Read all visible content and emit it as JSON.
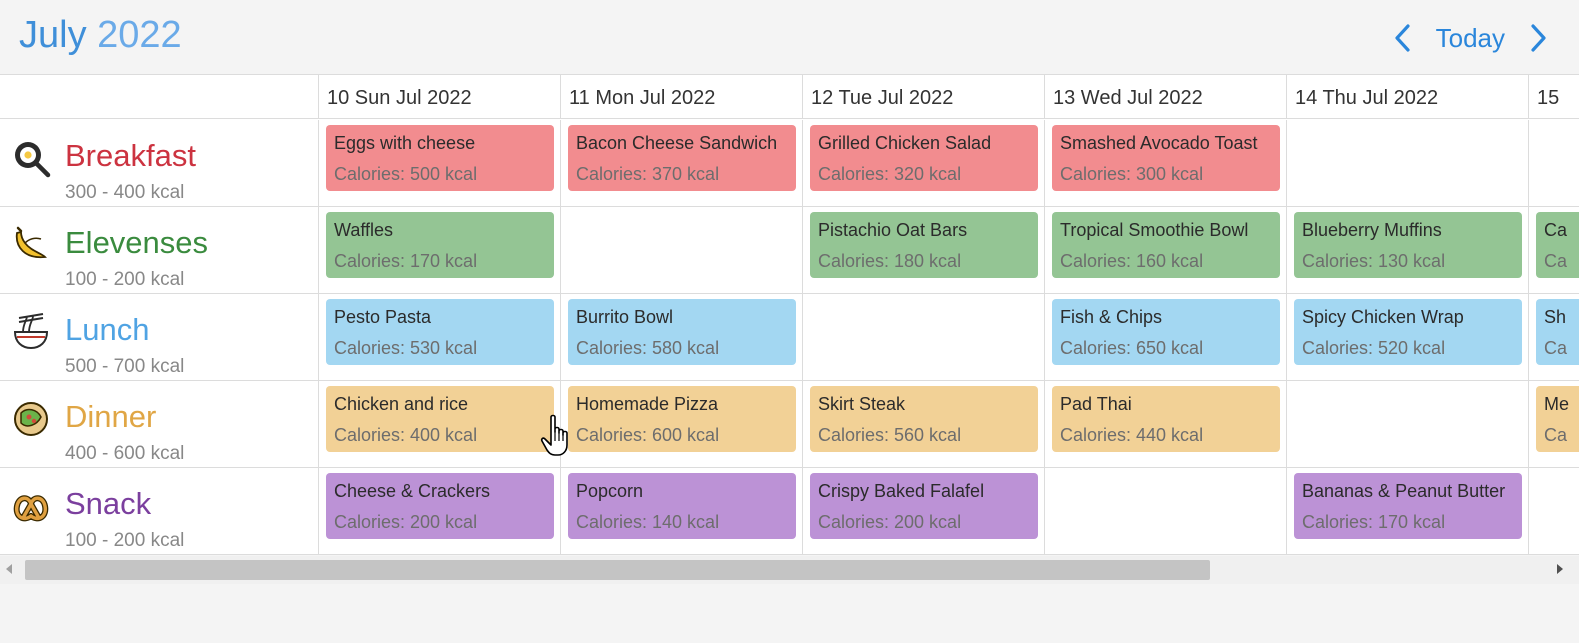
{
  "header": {
    "month": "July",
    "year": "2022",
    "today_label": "Today",
    "prev_icon": "chevron-left-icon",
    "next_icon": "chevron-right-icon"
  },
  "days": [
    "10 Sun Jul 2022",
    "11 Mon Jul 2022",
    "12 Tue Jul 2022",
    "13 Wed Jul 2022",
    "14 Thu Jul 2022",
    "15"
  ],
  "meals": [
    {
      "name": "Breakfast",
      "range": "300 - 400 kcal",
      "color": "#cc3340",
      "icon": "frying-pan-icon",
      "event_color": "#f28c8f",
      "events": [
        {
          "title": "Eggs with cheese",
          "cal": "Calories: 500 kcal"
        },
        {
          "title": "Bacon Cheese Sandwich",
          "cal": "Calories: 370 kcal"
        },
        {
          "title": "Grilled Chicken Salad",
          "cal": "Calories: 320 kcal"
        },
        {
          "title": "Smashed Avocado Toast",
          "cal": "Calories: 300 kcal"
        },
        null,
        null
      ]
    },
    {
      "name": "Elevenses",
      "range": "100 - 200 kcal",
      "color": "#3a8b3e",
      "icon": "banana-icon",
      "event_color": "#94c594",
      "events": [
        {
          "title": "Waffles",
          "cal": "Calories: 170 kcal"
        },
        null,
        {
          "title": "Pistachio Oat Bars",
          "cal": "Calories: 180 kcal"
        },
        {
          "title": "Tropical Smoothie Bowl",
          "cal": "Calories: 160 kcal"
        },
        {
          "title": "Blueberry Muffins",
          "cal": "Calories: 130 kcal"
        },
        {
          "title": "Ca",
          "cal": "Ca"
        }
      ]
    },
    {
      "name": "Lunch",
      "range": "500 - 700 kcal",
      "color": "#4fa3e3",
      "icon": "noodle-bowl-icon",
      "event_color": "#a3d7f2",
      "events": [
        {
          "title": "Pesto Pasta",
          "cal": "Calories: 530 kcal"
        },
        {
          "title": "Burrito Bowl",
          "cal": "Calories: 580 kcal"
        },
        null,
        {
          "title": "Fish & Chips",
          "cal": "Calories: 650 kcal"
        },
        {
          "title": "Spicy Chicken Wrap",
          "cal": "Calories: 520 kcal"
        },
        {
          "title": "Sh",
          "cal": "Ca"
        }
      ]
    },
    {
      "name": "Dinner",
      "range": "400 - 600 kcal",
      "color": "#e0a645",
      "icon": "taco-icon",
      "event_color": "#f2d196",
      "events": [
        {
          "title": "Chicken and rice",
          "cal": "Calories: 400 kcal"
        },
        {
          "title": "Homemade Pizza",
          "cal": "Calories: 600 kcal"
        },
        {
          "title": "Skirt Steak",
          "cal": "Calories: 560 kcal"
        },
        {
          "title": "Pad Thai",
          "cal": "Calories: 440 kcal"
        },
        null,
        {
          "title": "Me",
          "cal": "Ca"
        }
      ]
    },
    {
      "name": "Snack",
      "range": "100 - 200 kcal",
      "color": "#7b3f9e",
      "icon": "pretzel-icon",
      "event_color": "#bc92d6",
      "events": [
        {
          "title": "Cheese & Crackers",
          "cal": "Calories: 200 kcal"
        },
        {
          "title": "Popcorn",
          "cal": "Calories: 140 kcal"
        },
        {
          "title": "Crispy Baked Falafel",
          "cal": "Calories: 200 kcal"
        },
        null,
        {
          "title": "Bananas & Peanut Butter",
          "cal": "Calories: 170 kcal"
        },
        null
      ]
    }
  ]
}
